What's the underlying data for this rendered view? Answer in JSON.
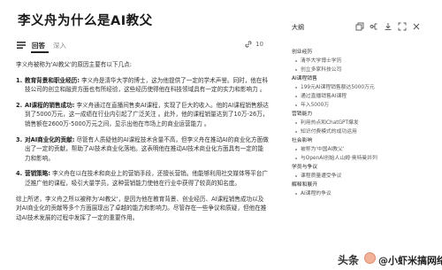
{
  "article": {
    "title": "李义舟为什么是AI教父",
    "tabs": [
      "回答",
      "深入"
    ],
    "link_count": "10"
  },
  "content": {
    "intro": "李义舟被称为'AI教父'的原因主要有以下几点:",
    "items": [
      {
        "num": "1.",
        "heading": "教育背景和职业经历:",
        "text": "李义舟是清华大学的博士，这为他提供了一定的学术声誉。同时，他在科技公司的创立和融资方面也有所经验，这些经历使得他在科技领域具有一定的实力和影响力 。"
      },
      {
        "num": "2.",
        "heading": "AI课程的销售成功:",
        "text": "李义舟通过在直播间售卖AI课程，实现了巨大的收入。他的AI课程销售额达到了5000万元，这一成绩在行业内引起了广泛关注 。此外，他的课程销量达到了10万-26万，销售额在2600万-5000万元之间，显示出他在市场上的商业运营能力 。"
      },
      {
        "num": "3.",
        "heading": "对AI商业化的贡献:",
        "text": "尽管有人质疑他的AI课程技术含量不高，但李义舟在推动AI的商业化方面做出了一定的贡献，帮助了AI技术商业化落地。这表明他在推动AI技术商业化方面具有一定的能力和影响。"
      },
      {
        "num": "4.",
        "heading": "营销策略:",
        "text": "李义舟在以在技术和商业上的营销手段，还擅长营销。他能够利用社交媒体等平台广泛推广他的课程，吸引大量学员，这种营销能力使他在行业中获得了较高的知名度。"
      }
    ],
    "summary": "综上所述，李义舟之所以被称为'AI教父'，是因为他在教育背景、创业经历、AI课程销售成功以及对AI商业化的贡献等多个方面展现出了卓越的能力和影响力。尽管存在一些争议和质疑，但他在推动AI技术发展的过程中发挥了一定的重要作用。"
  },
  "outline": {
    "title": "大纲",
    "sections": [
      {
        "heading": "创业经历",
        "items": [
          "清华大学博士学历",
          "创立多家科技公司"
        ]
      },
      {
        "heading": "AI课程销售",
        "items": [
          "199元AI课程销售额达5000万元",
          "通过直播销售AI课程",
          "年入5000万"
        ]
      },
      {
        "heading": "营销能力",
        "items": [
          "利用热点和ChatGPT爆发",
          "知识付费模式的成功运用"
        ]
      },
      {
        "heading": "社会影响",
        "items": [
          "被称为'中国AI教父'",
          "与OpenAI创始人山姆·奥特曼并列"
        ]
      },
      {
        "heading": "学员与争议",
        "items": [
          "课程质量遭受争议"
        ]
      },
      {
        "heading": "解释和展开",
        "items": [
          "AI课程的争议"
        ]
      }
    ]
  },
  "watermark": {
    "logo": "头条",
    "handle": "@小虾米搞网络"
  }
}
